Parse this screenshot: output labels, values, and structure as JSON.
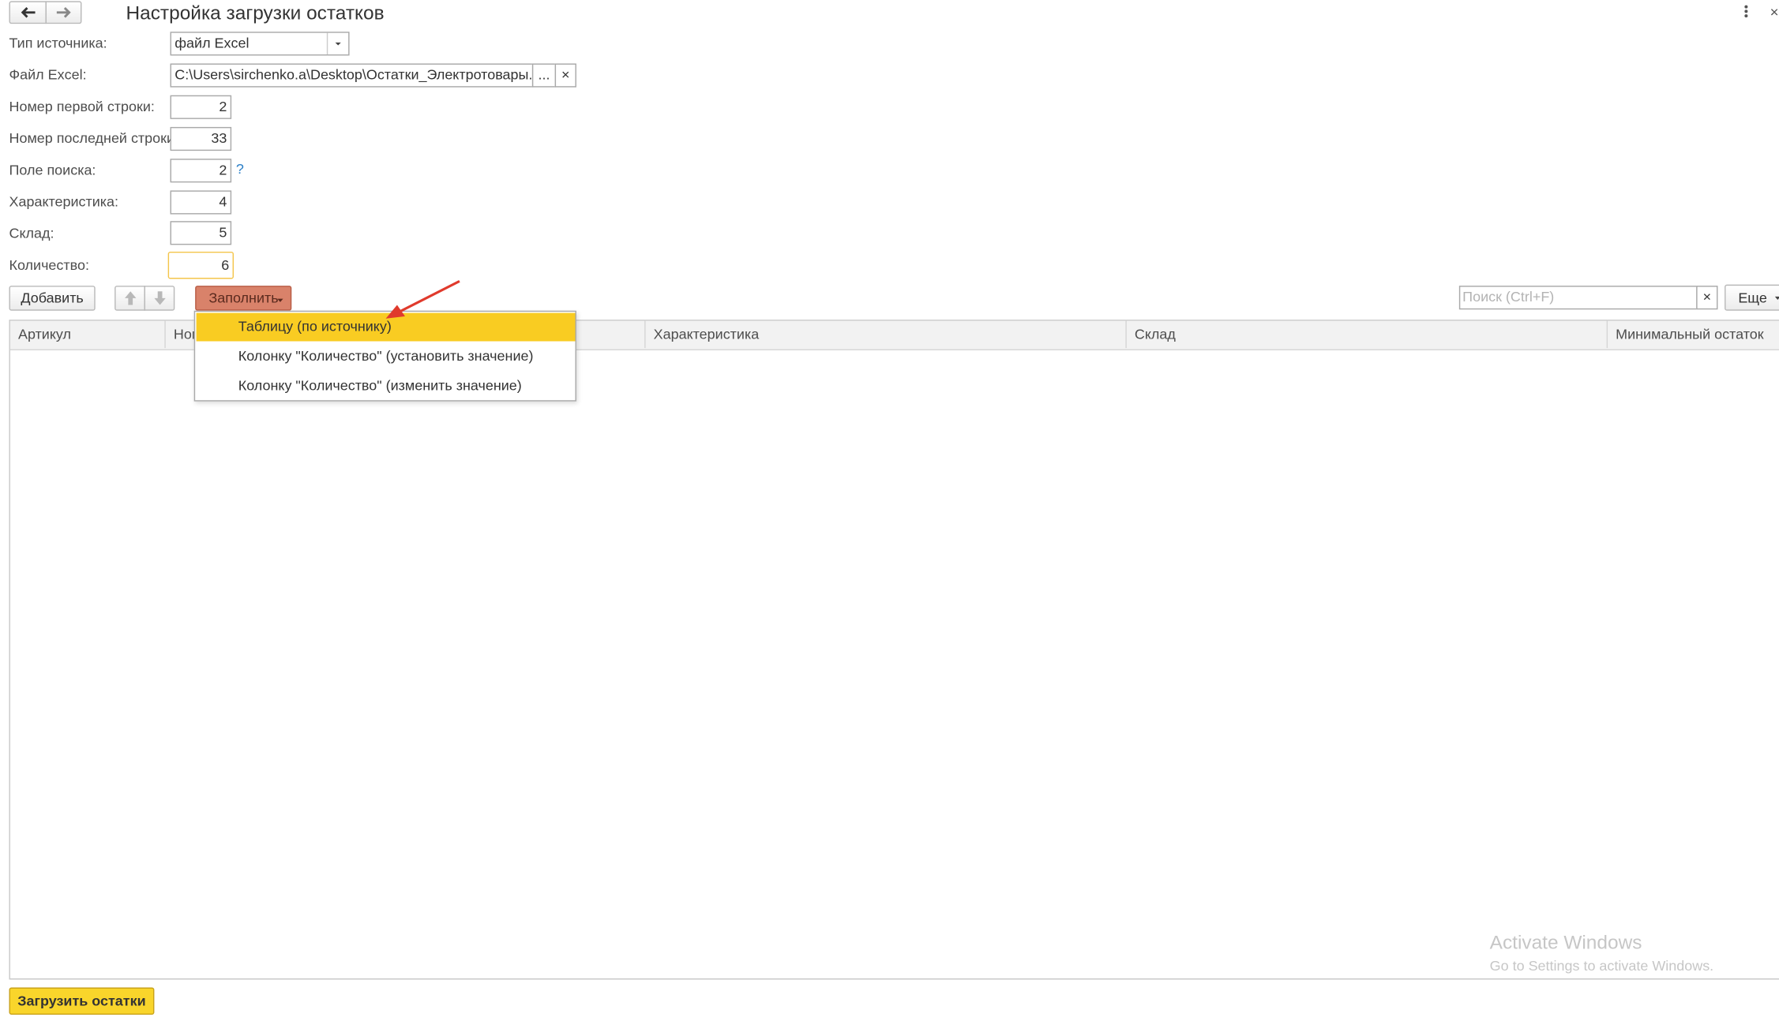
{
  "window": {
    "title": "Настройка загрузки остатков",
    "back_icon": "arrow-left-icon",
    "forward_icon": "arrow-right-icon",
    "more_icon": "vertical-dots-icon",
    "close_icon": "close-icon"
  },
  "form": {
    "source_type": {
      "label": "Тип источника:",
      "value": "файл Excel"
    },
    "excel_file": {
      "label": "Файл Excel:",
      "value": "C:\\Users\\sirchenko.a\\Desktop\\Остатки_Электротовары.xlsx",
      "choose_label": "...",
      "clear_label": "×"
    },
    "first_row": {
      "label": "Номер первой строки:",
      "value": "2"
    },
    "last_row": {
      "label": "Номер последней строки:",
      "value": "33"
    },
    "search_field": {
      "label": "Поле поиска:",
      "value": "2",
      "help": "?"
    },
    "characteristic": {
      "label": "Характеристика:",
      "value": "4"
    },
    "warehouse": {
      "label": "Склад:",
      "value": "5"
    },
    "quantity": {
      "label": "Количество:",
      "value": "6"
    }
  },
  "toolbar": {
    "add_label": "Добавить",
    "fill_label": "Заполнить",
    "search_placeholder": "Поиск (Ctrl+F)",
    "search_clear": "×",
    "more_label": "Еще"
  },
  "fill_menu": {
    "items": [
      {
        "label": "Таблицу (по источнику)",
        "highlighted": true
      },
      {
        "label": "Колонку \"Количество\" (установить значение)",
        "highlighted": false
      },
      {
        "label": "Колонку \"Количество\" (изменить значение)",
        "highlighted": false
      }
    ]
  },
  "table": {
    "columns": [
      "Артикул",
      "Номенклатура",
      "Характеристика",
      "Склад",
      "Минимальный остаток"
    ],
    "visible_column_stub": "Ном",
    "rows": []
  },
  "footer": {
    "load_label": "Загрузить остатки"
  },
  "watermark": {
    "line1": "Activate Windows",
    "line2": "Go to Settings to activate Windows."
  },
  "colors": {
    "accent_yellow": "#f9cc22",
    "fill_button": "#d9826a",
    "focus_border": "#f4c54b",
    "arrow": "#e03a2c",
    "help": "#2a7fc7"
  }
}
